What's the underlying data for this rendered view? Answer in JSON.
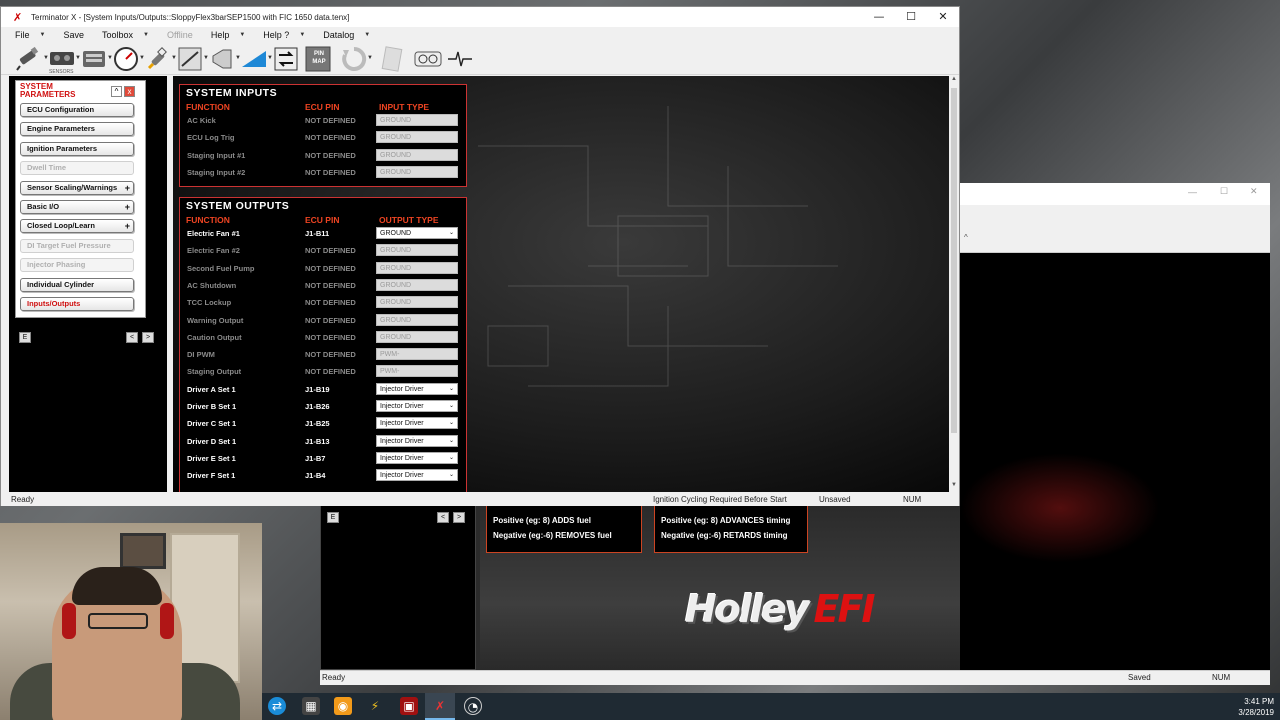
{
  "window": {
    "title": "Terminator X - [System Inputs/Outputs::SloppyFlex3barSEP1500 with FIC 1650 data.tenx]",
    "minimize": "—",
    "maximize": "☐",
    "close": "✕"
  },
  "menu": [
    {
      "label": "File",
      "caret": true
    },
    {
      "label": "Save",
      "caret": false
    },
    {
      "label": "Toolbox",
      "caret": true
    },
    {
      "label": "Offline",
      "caret": false,
      "disabled": true
    },
    {
      "label": "Help",
      "caret": true
    },
    {
      "label": "Help ?",
      "caret": true
    },
    {
      "label": "Datalog",
      "caret": true
    }
  ],
  "toolbar": {
    "sensors_label": "SENSORS",
    "pin_map_label": "PIN MAP",
    "icons": [
      "injector-icon",
      "sensors-icon",
      "ecu-icon",
      "gauge-icon",
      "spark-plug-icon",
      "table-icon",
      "horn-icon",
      "triangle-icon",
      "transfer-icon",
      "pin-map-icon",
      "refresh-icon",
      "notes-icon",
      "meter-icon",
      "waveform-icon"
    ]
  },
  "system_parameters": {
    "title": "SYSTEM PARAMETERS",
    "collapse": "^",
    "close": "x",
    "items": [
      {
        "label": "ECU Configuration",
        "state": "normal",
        "plus": ""
      },
      {
        "label": "Engine Parameters",
        "state": "normal",
        "plus": ""
      },
      {
        "label": "Ignition Parameters",
        "state": "normal",
        "plus": ""
      },
      {
        "label": "Dwell Time",
        "state": "disabled",
        "plus": ""
      },
      {
        "label": "Sensor Scaling/Warnings",
        "state": "normal",
        "plus": "+"
      },
      {
        "label": "Basic I/O",
        "state": "normal",
        "plus": "+"
      },
      {
        "label": "Closed Loop/Learn",
        "state": "normal",
        "plus": "+"
      },
      {
        "label": "DI Target Fuel Pressure",
        "state": "disabled",
        "plus": ""
      },
      {
        "label": "Injector Phasing",
        "state": "disabled",
        "plus": ""
      },
      {
        "label": "Individual Cylinder",
        "state": "normal",
        "plus": ""
      },
      {
        "label": "Inputs/Outputs",
        "state": "selected",
        "plus": ""
      }
    ]
  },
  "left_bar": {
    "e_button": "E",
    "prev": "<",
    "next": ">"
  },
  "system_inputs": {
    "title": "SYSTEM INPUTS",
    "col_function": "FUNCTION",
    "col_pin": "ECU PIN",
    "col_type": "INPUT TYPE",
    "rows": [
      {
        "function": "AC Kick",
        "pin": "NOT DEFINED",
        "type": "GROUND",
        "enabled": false
      },
      {
        "function": "ECU Log Trig",
        "pin": "NOT DEFINED",
        "type": "GROUND",
        "enabled": false
      },
      {
        "function": "Staging Input #1",
        "pin": "NOT DEFINED",
        "type": "GROUND",
        "enabled": false
      },
      {
        "function": "Staging Input #2",
        "pin": "NOT DEFINED",
        "type": "GROUND",
        "enabled": false
      }
    ]
  },
  "system_outputs": {
    "title": "SYSTEM OUTPUTS",
    "col_function": "FUNCTION",
    "col_pin": "ECU PIN",
    "col_type": "OUTPUT TYPE",
    "rows": [
      {
        "function": "Electric Fan #1",
        "pin": "J1-B11",
        "type": "GROUND",
        "enabled": true
      },
      {
        "function": "Electric Fan #2",
        "pin": "NOT DEFINED",
        "type": "GROUND",
        "enabled": false
      },
      {
        "function": "Second Fuel Pump",
        "pin": "NOT DEFINED",
        "type": "GROUND",
        "enabled": false
      },
      {
        "function": "AC Shutdown",
        "pin": "NOT DEFINED",
        "type": "GROUND",
        "enabled": false
      },
      {
        "function": "TCC Lockup",
        "pin": "NOT DEFINED",
        "type": "GROUND",
        "enabled": false
      },
      {
        "function": "Warning Output",
        "pin": "NOT DEFINED",
        "type": "GROUND",
        "enabled": false
      },
      {
        "function": "Caution Output",
        "pin": "NOT DEFINED",
        "type": "GROUND",
        "enabled": false
      },
      {
        "function": "DI PWM",
        "pin": "NOT DEFINED",
        "type": "PWM-",
        "enabled": false
      },
      {
        "function": "Staging Output",
        "pin": "NOT DEFINED",
        "type": "PWM-",
        "enabled": false
      },
      {
        "function": "Driver A Set 1",
        "pin": "J1-B19",
        "type": "Injector Driver",
        "enabled": true
      },
      {
        "function": "Driver B Set 1",
        "pin": "J1-B26",
        "type": "Injector Driver",
        "enabled": true
      },
      {
        "function": "Driver C Set 1",
        "pin": "J1-B25",
        "type": "Injector Driver",
        "enabled": true
      },
      {
        "function": "Driver D Set 1",
        "pin": "J1-B13",
        "type": "Injector Driver",
        "enabled": true
      },
      {
        "function": "Driver E Set 1",
        "pin": "J1-B7",
        "type": "Injector Driver",
        "enabled": true
      },
      {
        "function": "Driver F Set 1",
        "pin": "J1-B4",
        "type": "Injector Driver",
        "enabled": true
      }
    ]
  },
  "status": {
    "ready": "Ready",
    "ignition": "Ignition Cycling Required Before Start",
    "saved_state": "Unsaved",
    "num": "NUM"
  },
  "background_app": {
    "fuel_pos": "Positive (eg: 8) ADDS fuel",
    "fuel_neg": "Negative (eg:-6) REMOVES fuel",
    "timing_pos": "Positive (eg: 8) ADVANCES timing",
    "timing_neg": "Negative (eg:-6) RETARDS timing",
    "logo_a": "Holley",
    "logo_b": "EFI",
    "status_ready": "Ready",
    "status_saved": "Saved",
    "status_num": "NUM",
    "e_button": "E",
    "prev": "<",
    "next": ">"
  },
  "taskbar": {
    "time": "3:41 PM",
    "date": "3/28/2019"
  }
}
